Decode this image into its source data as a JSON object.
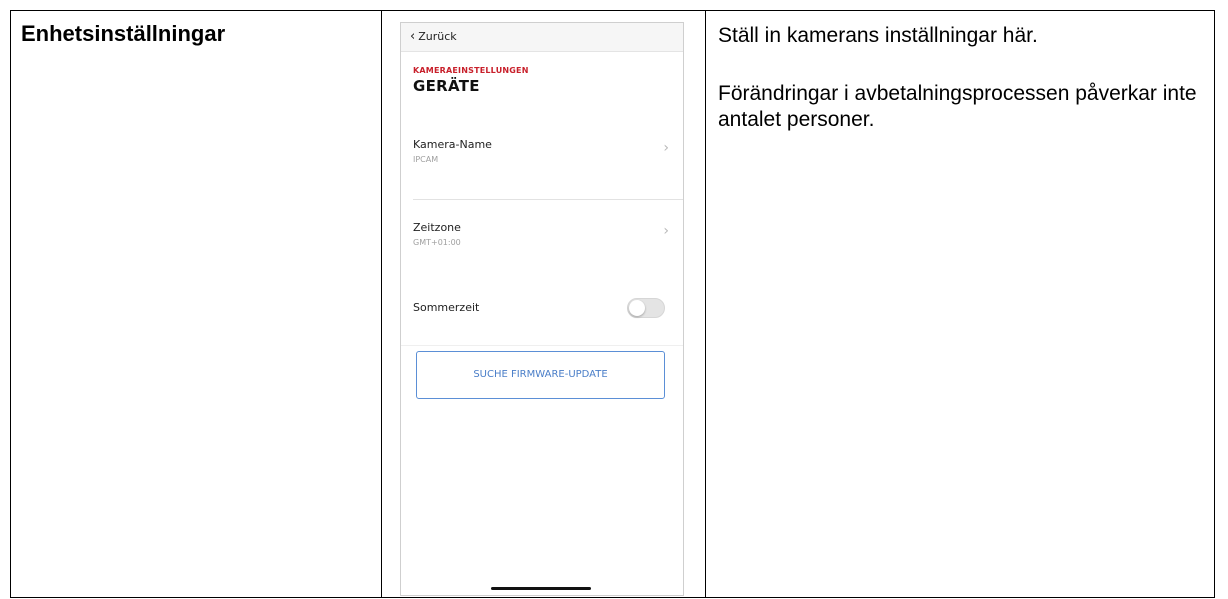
{
  "row": {
    "title": "Enhetsinställningar",
    "description": [
      "Ställ in kamerans inställningar här.",
      "Förändringar i avbetalningsprocessen påverkar inte antalet personer."
    ]
  },
  "phone": {
    "back_label": "Zurück",
    "section_eyebrow": "KAMERAEINSTELLUNGEN",
    "section_title": "GERÄTE",
    "camera_name": {
      "label": "Kamera-Name",
      "value": "IPCAM"
    },
    "timezone": {
      "label": "Zeitzone",
      "value": "GMT+01:00"
    },
    "dst": {
      "label": "Sommerzeit",
      "enabled": false
    },
    "firmware_button": "SUCHE FIRMWARE-UPDATE",
    "accent_color": "#c8202b",
    "button_color": "#4a7ec8"
  }
}
